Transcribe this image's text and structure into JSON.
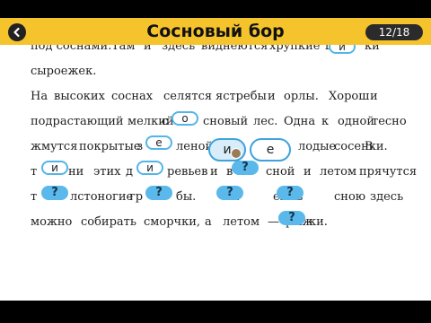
{
  "header": {
    "title": "Сосновый бор",
    "counter": "12/18",
    "back_icon": "back-arrow-icon"
  },
  "text_lines": [
    [
      "под соснами.",
      "Там",
      "и",
      "здесь",
      "виднеются",
      "хрупкие",
      "шля",
      "ки"
    ],
    [
      "сыроежек."
    ],
    [
      "На",
      "высоких",
      "соснах",
      "селятся",
      "ястребы",
      "и",
      "орлы.",
      "Хорош",
      "и"
    ],
    [
      "подрастающий",
      "мелкий",
      "с",
      "сновый",
      "лес.",
      "Одна",
      "к",
      "одной",
      "тесно"
    ],
    [
      "жмутся",
      "покрытые",
      "з",
      "леной",
      "лодые",
      "сосенки.",
      "В"
    ],
    [
      "т",
      "ни",
      "этих",
      "д",
      "ревьев",
      "и",
      "в",
      "сной",
      "и",
      "летом",
      "прячутся"
    ],
    [
      "т",
      "лстоногие",
      "гр",
      "бы.",
      "Ра",
      "ей",
      "в",
      "сною",
      "здесь"
    ],
    [
      "можно",
      "собирать",
      "сморчки,",
      "а",
      "летом",
      "—",
      "рыж",
      "ки."
    ]
  ],
  "answer_slots": {
    "line1_1": "и",
    "line4_1": "о",
    "line5_1": "е",
    "line6_1": "и",
    "line6_2": "и",
    "line6_3": "?",
    "line7_1": "?",
    "line7_2": "?",
    "line7_3": "?",
    "line7_4": "?",
    "line8_1": "?"
  },
  "choices": {
    "option_a": "и",
    "option_b": "е"
  }
}
